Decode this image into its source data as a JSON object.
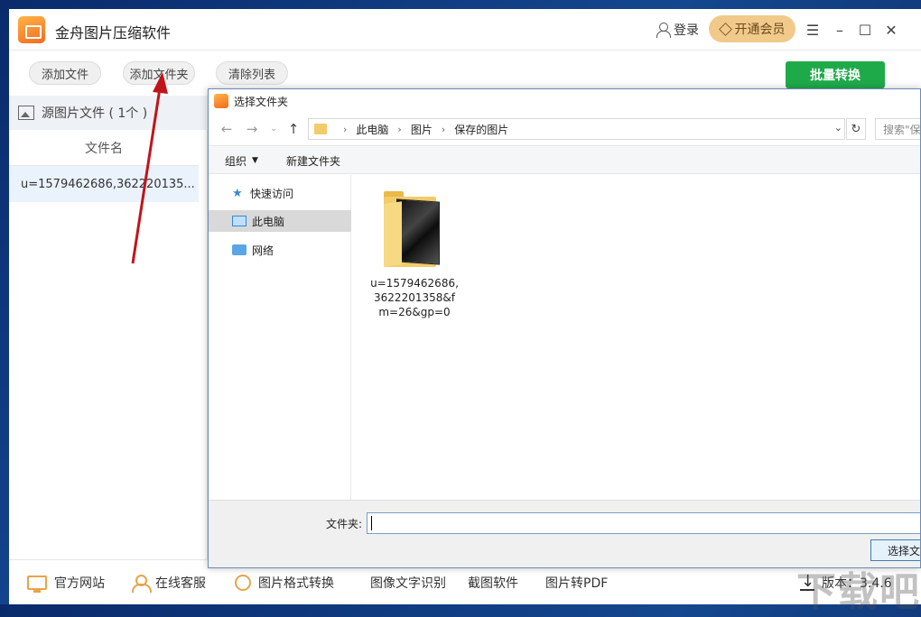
{
  "app": {
    "title": "金舟图片压缩软件",
    "login": "登录",
    "vip": "开通会员"
  },
  "window_controls": {
    "menu": "☰",
    "minimize": "–",
    "maximize": "☐",
    "close": "✕"
  },
  "toolbar": {
    "add_file": "添加文件",
    "add_folder": "添加文件夹",
    "clear_list": "清除列表",
    "batch_convert": "批量转换"
  },
  "left_panel": {
    "source_header": "源图片文件 ( 1个 )",
    "column_filename": "文件名",
    "files": [
      "u=1579462686,362220135..."
    ]
  },
  "status_bar": {
    "official_site": "官方网站",
    "online_service": "在线客服",
    "format_convert": "图片格式转换",
    "ocr": "图像文字识别",
    "screenshot": "截图软件",
    "to_pdf": "图片转PDF",
    "version": "版本：3.4.6"
  },
  "dialog": {
    "title": "选择文件夹",
    "breadcrumb": [
      "此电脑",
      "图片",
      "保存的图片"
    ],
    "search_placeholder": "搜索\"保存的图片\"",
    "organize": "组织",
    "new_folder": "新建文件夹",
    "nav_items": [
      "快速访问",
      "此电脑",
      "网络"
    ],
    "folder_name": "u=1579462686,3622201358&fm=26&gp=0",
    "folder_label": "文件夹:",
    "select_button": "选择文件夹"
  },
  "watermark": "下载吧"
}
